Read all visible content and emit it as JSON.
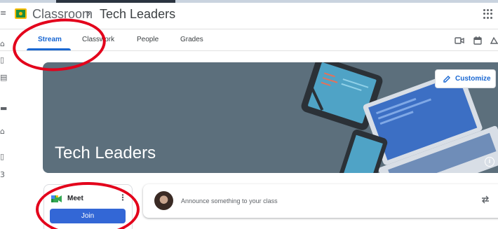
{
  "header": {
    "brand": "Classroom",
    "separator": "›",
    "class_name": "Tech Leaders",
    "apps_icon": "google-apps-icon"
  },
  "tabs": [
    {
      "label": "Stream",
      "active": true
    },
    {
      "label": "Classwork",
      "active": false
    },
    {
      "label": "People",
      "active": false
    },
    {
      "label": "Grades",
      "active": false
    }
  ],
  "toolbar_icons": [
    "video-call-icon",
    "calendar-icon",
    "drive-folder-icon"
  ],
  "banner": {
    "title": "Tech Leaders",
    "customize_label": "Customize",
    "info_icon": "info-icon",
    "background_color": "#5c6f7c"
  },
  "meet": {
    "label": "Meet",
    "join_label": "Join",
    "join_color": "#3367d6"
  },
  "announce": {
    "placeholder": "Announce something to your class"
  },
  "accent_color": "#1967d2",
  "annotation_color": "#e3001b"
}
